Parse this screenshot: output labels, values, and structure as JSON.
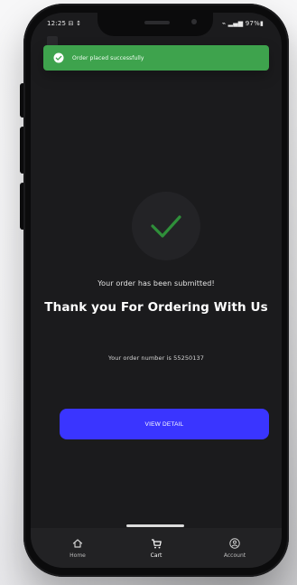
{
  "status_bar": {
    "time": "12:25 ⊟ ↕",
    "right": "⌁ ▂▄▆ 97%▮"
  },
  "toast": {
    "message": "Order placed successfully",
    "icon": "check-circle-icon",
    "color": "#3ea34d"
  },
  "confirmation": {
    "submitted_text": "Your order has been submitted!",
    "thank_you_text": "Thank you For Ordering With Us",
    "order_number_text": "Your order number is 55250137",
    "check_icon": "checkmark-icon",
    "check_color": "#2f8f3a"
  },
  "actions": {
    "view_details_label": "VIEW DETAIL",
    "view_details_color": "#3a35ff"
  },
  "bottom_nav": {
    "items": [
      {
        "label": "Home",
        "icon": "home-icon"
      },
      {
        "label": "Cart",
        "icon": "cart-icon"
      },
      {
        "label": "Account",
        "icon": "account-icon"
      }
    ]
  }
}
